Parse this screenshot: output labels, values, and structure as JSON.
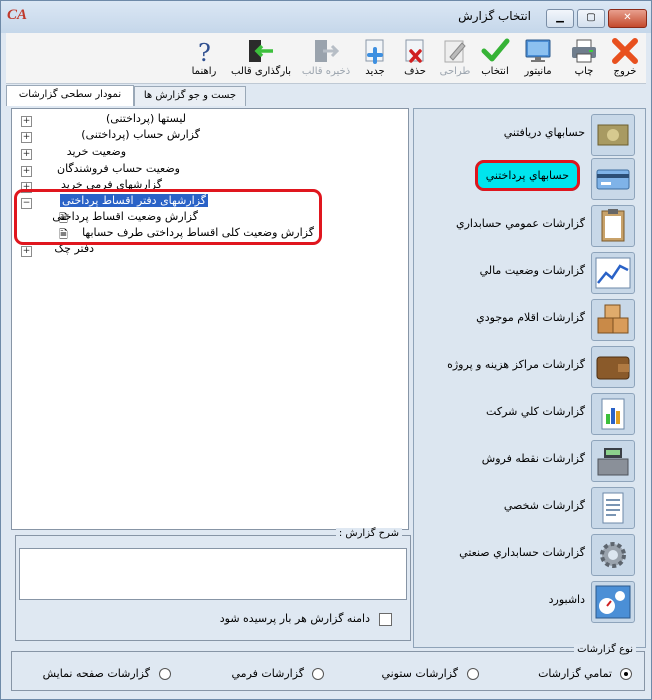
{
  "window": {
    "title": "انتخاب گزارش",
    "app_logo": "CA"
  },
  "toolbar": [
    {
      "id": "exit",
      "label": "خروج",
      "icon": "close-x-icon",
      "disabled": false
    },
    {
      "id": "print",
      "label": "چاپ",
      "icon": "printer-icon",
      "disabled": false
    },
    {
      "id": "monitor",
      "label": "مانیتور",
      "icon": "monitor-icon",
      "disabled": false
    },
    {
      "id": "select",
      "label": "انتخاب",
      "icon": "checkmark-icon",
      "disabled": false
    },
    {
      "id": "design",
      "label": "طراحی",
      "icon": "pen-icon",
      "disabled": true
    },
    {
      "id": "delete",
      "label": "حذف",
      "icon": "delete-document-icon",
      "disabled": false
    },
    {
      "id": "new",
      "label": "جدید",
      "icon": "new-document-icon",
      "disabled": false
    },
    {
      "id": "save_template",
      "label": "ذخیره قالب",
      "icon": "save-template-icon",
      "disabled": true
    },
    {
      "id": "load_template",
      "label": "بارگذاری قالب",
      "icon": "load-template-icon",
      "disabled": false
    },
    {
      "id": "help",
      "label": "راهنما",
      "icon": "question-mark-icon",
      "disabled": false
    }
  ],
  "tabs": [
    {
      "label": "نمودار سطحی گزارشات",
      "active": true
    },
    {
      "label": "جست و جو گزارش ها",
      "active": false
    }
  ],
  "tree": [
    {
      "label": "لیستها (پرداختنی)",
      "level": 0,
      "expander": "+"
    },
    {
      "label": "گزارش حساب (پرداختنی)",
      "level": 0,
      "expander": "+"
    },
    {
      "label": "وضعیت خرید",
      "level": 0,
      "expander": "+"
    },
    {
      "label": "وضعیت حساب فروشندگان",
      "level": 0,
      "expander": "+"
    },
    {
      "label": "گزارشهای فرمی خرید",
      "level": 0,
      "expander": "+"
    },
    {
      "label": "گزارشهای دفتر اقساط پرداختی",
      "level": 0,
      "expander": "-",
      "selected": true
    },
    {
      "label": "گزارش وضعیت اقساط پرداختی",
      "level": 1
    },
    {
      "label": "گزارش وضعیت کلی اقساط پرداختی طرف حسابها",
      "level": 1
    },
    {
      "label": "دفتر چک",
      "level": 0,
      "expander": "+"
    }
  ],
  "description": {
    "label": "شرح گزارش :",
    "value": ""
  },
  "checkbox": {
    "label": "دامنه گزارش هر بار پرسیده شود",
    "checked": false
  },
  "categories": [
    {
      "label": "حسابهاي دريافتني",
      "icon": "money-icon"
    },
    {
      "label": "حسابهاي پرداختني",
      "icon": "credit-card-icon",
      "highlighted": true
    },
    {
      "label": "گزارشات عمومي حسابداري",
      "icon": "clipboard-icon"
    },
    {
      "label": "گزارشات وضعيت مالي",
      "icon": "line-chart-icon"
    },
    {
      "label": "گزارشات اقلام موجودي",
      "icon": "boxes-icon"
    },
    {
      "label": "گزارشات مراكز هزينه و پروژه",
      "icon": "wallet-icon"
    },
    {
      "label": "گزارشات كلي شركت",
      "icon": "report-chart-icon"
    },
    {
      "label": "گزارشات نقطه فروش",
      "icon": "cash-register-icon"
    },
    {
      "label": "گزارشات شخصي",
      "icon": "document-icon"
    },
    {
      "label": "گزارشات حسابداري صنعتي",
      "icon": "gear-icon"
    },
    {
      "label": "داشبورد",
      "icon": "dashboard-gauge-icon"
    }
  ],
  "report_type": {
    "label": "نوع گزارشات",
    "options": [
      {
        "label": "تمامي گزارشات",
        "checked": true
      },
      {
        "label": "گزارشات ستوني",
        "checked": false
      },
      {
        "label": "گزارشات فرمي",
        "checked": false
      },
      {
        "label": "گزارشات صفحه نمايش",
        "checked": false
      }
    ]
  },
  "colors": {
    "selection": "#2a62c7",
    "highlight_box": "#e0161e",
    "highlight_fill": "#00e5ee"
  }
}
